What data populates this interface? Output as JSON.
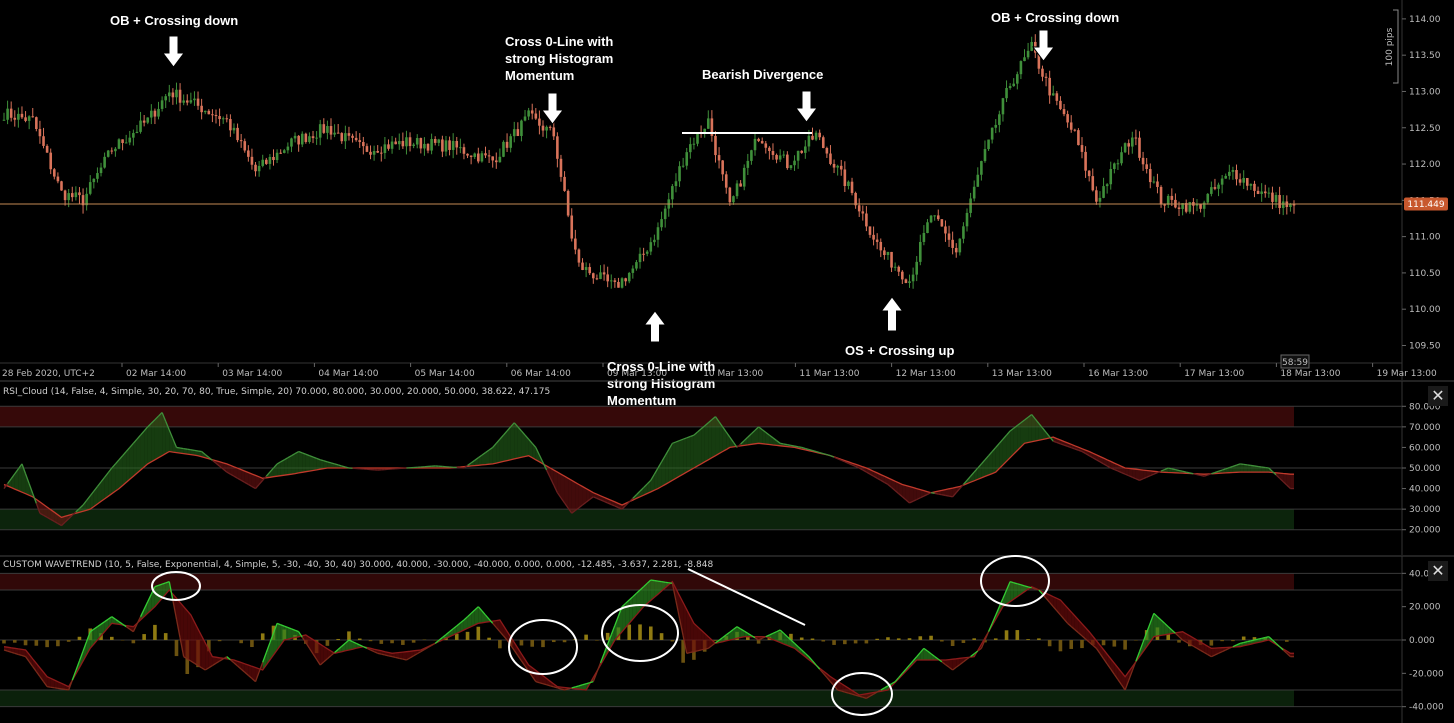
{
  "chart_data": [
    {
      "type": "candlestick",
      "timezone_label": "28 Feb 2020, UTC+2",
      "x_tick_labels": [
        "02 Mar 14:00",
        "03 Mar 14:00",
        "04 Mar 14:00",
        "05 Mar 14:00",
        "06 Mar 14:00",
        "09 Mar 13:00",
        "10 Mar 13:00",
        "11 Mar 13:00",
        "12 Mar 13:00",
        "13 Mar 13:00",
        "16 Mar 13:00",
        "17 Mar 13:00",
        "18 Mar 13:00",
        "19 Mar 13:00"
      ],
      "y_ticks": [
        114.0,
        113.5,
        113.0,
        112.5,
        112.0,
        111.5,
        111.0,
        110.5,
        110.0,
        109.5
      ],
      "y_tick_labels": [
        "114.00",
        "113.50",
        "113.00",
        "112.50",
        "112.00",
        "111.50",
        "111.00",
        "110.50",
        "110.00",
        "109.50"
      ],
      "ylim": [
        109.3,
        114.15
      ],
      "last_price": 111.449,
      "last_price_label": "111.449",
      "scale_label": "100 pips",
      "countdown": "58:59",
      "anchors": [
        [
          0,
          112.7
        ],
        [
          8,
          112.6
        ],
        [
          16,
          111.6
        ],
        [
          22,
          111.5
        ],
        [
          30,
          112.2
        ],
        [
          40,
          112.6
        ],
        [
          46,
          113.0
        ],
        [
          54,
          112.8
        ],
        [
          62,
          112.6
        ],
        [
          70,
          111.9
        ],
        [
          80,
          112.3
        ],
        [
          90,
          112.5
        ],
        [
          100,
          112.2
        ],
        [
          112,
          112.3
        ],
        [
          124,
          112.25
        ],
        [
          136,
          112.05
        ],
        [
          146,
          112.65
        ],
        [
          153,
          112.4
        ],
        [
          158,
          111.0
        ],
        [
          160,
          110.6
        ],
        [
          170,
          110.3
        ],
        [
          176,
          110.6
        ],
        [
          182,
          111.1
        ],
        [
          190,
          112.2
        ],
        [
          196,
          112.6
        ],
        [
          202,
          111.4
        ],
        [
          210,
          112.4
        ],
        [
          218,
          112.0
        ],
        [
          226,
          112.4
        ],
        [
          236,
          111.6
        ],
        [
          244,
          110.8
        ],
        [
          252,
          110.4
        ],
        [
          258,
          111.3
        ],
        [
          265,
          110.8
        ],
        [
          272,
          112.0
        ],
        [
          280,
          113.1
        ],
        [
          286,
          113.6
        ],
        [
          292,
          112.9
        ],
        [
          298,
          112.4
        ],
        [
          304,
          111.5
        ],
        [
          314,
          112.4
        ],
        [
          322,
          111.5
        ],
        [
          332,
          111.4
        ],
        [
          342,
          111.9
        ],
        [
          350,
          111.6
        ],
        [
          358,
          111.4
        ]
      ],
      "annotations": [
        "OB + Crossing down",
        "Cross 0-Line with strong Histogram Momentum",
        "Bearish Divergence",
        "OB + Crossing down",
        "Cross 0-Line with strong Histogram Momentum",
        "OS + Crossing up"
      ]
    },
    {
      "type": "line",
      "title": "RSI_Cloud (14, False, 4, Simple, 30, 20, 70, 80, True, Simple, 20) 70.000, 80.000, 30.000, 20.000, 50.000, 38.622, 47.175",
      "y_ticks": [
        80,
        70,
        60,
        50,
        40,
        30,
        20
      ],
      "y_tick_labels": [
        "80.000",
        "70.000",
        "60.000",
        "50.000",
        "40.000",
        "30.000",
        "20.000"
      ],
      "ylim": [
        15,
        85
      ],
      "levels": [
        80,
        70,
        50,
        30,
        20
      ],
      "series": [
        {
          "anchors": [
            [
              0,
              40
            ],
            [
              5,
              52
            ],
            [
              10,
              28
            ],
            [
              16,
              22
            ],
            [
              22,
              32
            ],
            [
              30,
              50
            ],
            [
              40,
              70
            ],
            [
              44,
              77
            ],
            [
              48,
              60
            ],
            [
              55,
              58
            ],
            [
              62,
              48
            ],
            [
              70,
              40
            ],
            [
              76,
              52
            ],
            [
              82,
              58
            ],
            [
              88,
              54
            ],
            [
              96,
              50
            ],
            [
              104,
              49
            ],
            [
              112,
              50
            ],
            [
              120,
              51
            ],
            [
              128,
              50
            ],
            [
              136,
              60
            ],
            [
              142,
              72
            ],
            [
              148,
              60
            ],
            [
              154,
              38
            ],
            [
              158,
              28
            ],
            [
              164,
              36
            ],
            [
              172,
              30
            ],
            [
              180,
              44
            ],
            [
              186,
              62
            ],
            [
              192,
              66
            ],
            [
              198,
              75
            ],
            [
              204,
              60
            ],
            [
              210,
              70
            ],
            [
              216,
              62
            ],
            [
              222,
              60
            ],
            [
              230,
              56
            ],
            [
              238,
              50
            ],
            [
              246,
              42
            ],
            [
              252,
              33
            ],
            [
              258,
              38
            ],
            [
              264,
              36
            ],
            [
              272,
              52
            ],
            [
              280,
              68
            ],
            [
              286,
              76
            ],
            [
              292,
              63
            ],
            [
              300,
              58
            ],
            [
              308,
              50
            ],
            [
              316,
              44
            ],
            [
              324,
              50
            ],
            [
              334,
              46
            ],
            [
              344,
              52
            ],
            [
              352,
              50
            ],
            [
              358,
              40
            ]
          ]
        },
        {
          "anchors": [
            [
              0,
              42
            ],
            [
              8,
              36
            ],
            [
              16,
              26
            ],
            [
              24,
              30
            ],
            [
              32,
              40
            ],
            [
              40,
              52
            ],
            [
              46,
              58
            ],
            [
              54,
              56
            ],
            [
              62,
              52
            ],
            [
              72,
              45
            ],
            [
              80,
              47
            ],
            [
              90,
              50
            ],
            [
              100,
              50
            ],
            [
              112,
              50
            ],
            [
              124,
              50
            ],
            [
              136,
              52
            ],
            [
              146,
              56
            ],
            [
              154,
              48
            ],
            [
              164,
              38
            ],
            [
              172,
              32
            ],
            [
              182,
              40
            ],
            [
              192,
              50
            ],
            [
              202,
              60
            ],
            [
              210,
              62
            ],
            [
              220,
              60
            ],
            [
              230,
              56
            ],
            [
              240,
              50
            ],
            [
              250,
              42
            ],
            [
              258,
              38
            ],
            [
              266,
              41
            ],
            [
              276,
              48
            ],
            [
              284,
              62
            ],
            [
              292,
              65
            ],
            [
              302,
              58
            ],
            [
              312,
              50
            ],
            [
              322,
              48
            ],
            [
              334,
              47
            ],
            [
              344,
              48
            ],
            [
              352,
              48
            ],
            [
              358,
              47
            ]
          ]
        }
      ]
    },
    {
      "type": "line",
      "title": "CUSTOM WAVETREND (10, 5, False, Exponential, 4, Simple, 5, -30, -40, 30, 40) 30.000, 40.000, -30.000, -40.000, 0.000, 0.000, -12.485, -3.637, 2.281, -8.848",
      "y_ticks": [
        40,
        20,
        0,
        -20,
        -40
      ],
      "y_tick_labels": [
        "40.000",
        "20.000",
        "0.000",
        "-20.000",
        "-40.000"
      ],
      "ylim": [
        -42,
        42
      ],
      "levels": [
        40,
        30,
        0,
        -30,
        -40
      ],
      "series": [
        {
          "anchors": [
            [
              0,
              -6
            ],
            [
              6,
              -10
            ],
            [
              12,
              -28
            ],
            [
              18,
              -30
            ],
            [
              24,
              5
            ],
            [
              30,
              14
            ],
            [
              36,
              5
            ],
            [
              42,
              32
            ],
            [
              46,
              35
            ],
            [
              50,
              -10
            ],
            [
              56,
              -18
            ],
            [
              62,
              -10
            ],
            [
              70,
              -25
            ],
            [
              76,
              10
            ],
            [
              82,
              5
            ],
            [
              88,
              -15
            ],
            [
              96,
              0
            ],
            [
              104,
              -8
            ],
            [
              112,
              -12
            ],
            [
              120,
              -2
            ],
            [
              128,
              12
            ],
            [
              132,
              20
            ],
            [
              140,
              0
            ],
            [
              148,
              -25
            ],
            [
              156,
              -30
            ],
            [
              164,
              -25
            ],
            [
              172,
              20
            ],
            [
              180,
              36
            ],
            [
              186,
              34
            ],
            [
              190,
              -8
            ],
            [
              196,
              -5
            ],
            [
              204,
              8
            ],
            [
              210,
              0
            ],
            [
              216,
              6
            ],
            [
              224,
              -10
            ],
            [
              232,
              -30
            ],
            [
              240,
              -35
            ],
            [
              248,
              -25
            ],
            [
              256,
              -5
            ],
            [
              264,
              -18
            ],
            [
              272,
              -5
            ],
            [
              280,
              35
            ],
            [
              288,
              30
            ],
            [
              296,
              10
            ],
            [
              304,
              -5
            ],
            [
              312,
              -30
            ],
            [
              320,
              16
            ],
            [
              328,
              0
            ],
            [
              336,
              -10
            ],
            [
              344,
              -2
            ],
            [
              352,
              2
            ],
            [
              358,
              -10
            ]
          ]
        },
        {
          "anchors": [
            [
              0,
              -4
            ],
            [
              6,
              -6
            ],
            [
              12,
              -22
            ],
            [
              18,
              -28
            ],
            [
              24,
              -5
            ],
            [
              30,
              10
            ],
            [
              36,
              8
            ],
            [
              42,
              20
            ],
            [
              46,
              30
            ],
            [
              52,
              15
            ],
            [
              58,
              -10
            ],
            [
              64,
              -12
            ],
            [
              72,
              -18
            ],
            [
              78,
              0
            ],
            [
              84,
              3
            ],
            [
              92,
              -8
            ],
            [
              100,
              -4
            ],
            [
              108,
              -8
            ],
            [
              116,
              -6
            ],
            [
              124,
              2
            ],
            [
              132,
              10
            ],
            [
              138,
              12
            ],
            [
              146,
              -15
            ],
            [
              154,
              -28
            ],
            [
              162,
              -30
            ],
            [
              170,
              0
            ],
            [
              178,
              20
            ],
            [
              186,
              35
            ],
            [
              192,
              10
            ],
            [
              198,
              -2
            ],
            [
              206,
              2
            ],
            [
              212,
              2
            ],
            [
              220,
              -5
            ],
            [
              230,
              -22
            ],
            [
              238,
              -33
            ],
            [
              246,
              -30
            ],
            [
              254,
              -12
            ],
            [
              262,
              -12
            ],
            [
              270,
              -10
            ],
            [
              278,
              20
            ],
            [
              286,
              32
            ],
            [
              294,
              24
            ],
            [
              302,
              5
            ],
            [
              312,
              -22
            ],
            [
              320,
              2
            ],
            [
              328,
              5
            ],
            [
              336,
              -5
            ],
            [
              344,
              -4
            ],
            [
              352,
              0
            ],
            [
              358,
              -8
            ]
          ]
        }
      ]
    }
  ]
}
